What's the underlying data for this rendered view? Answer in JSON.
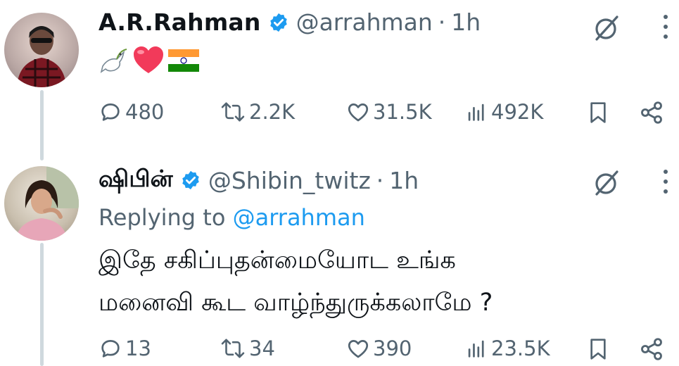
{
  "tweets": [
    {
      "name": "A.R.Rahman",
      "handle": "@arrahman",
      "separator": "·",
      "time": "1h",
      "emojis": [
        "dove-emoji",
        "heart-emoji",
        "india-flag-emoji"
      ],
      "actions": {
        "replies": "480",
        "reposts": "2.2K",
        "likes": "31.5K",
        "views": "492K"
      }
    },
    {
      "name": "ஷிபின்",
      "handle": "@Shibin_twitz",
      "separator": "·",
      "time": "1h",
      "replying_prefix": "Replying to",
      "replying_to": "@arrahman",
      "text_line1": "இதே சகிப்புதன்மையோட உங்க",
      "text_line2": "மனைவி கூட வாழ்ந்துருக்கலாமே ?",
      "actions": {
        "replies": "13",
        "reposts": "34",
        "likes": "390",
        "views": "23.5K"
      }
    }
  ],
  "colors": {
    "accent": "#1d9bf0",
    "secondary_text": "#536471",
    "thread_line": "#cfd9de"
  }
}
